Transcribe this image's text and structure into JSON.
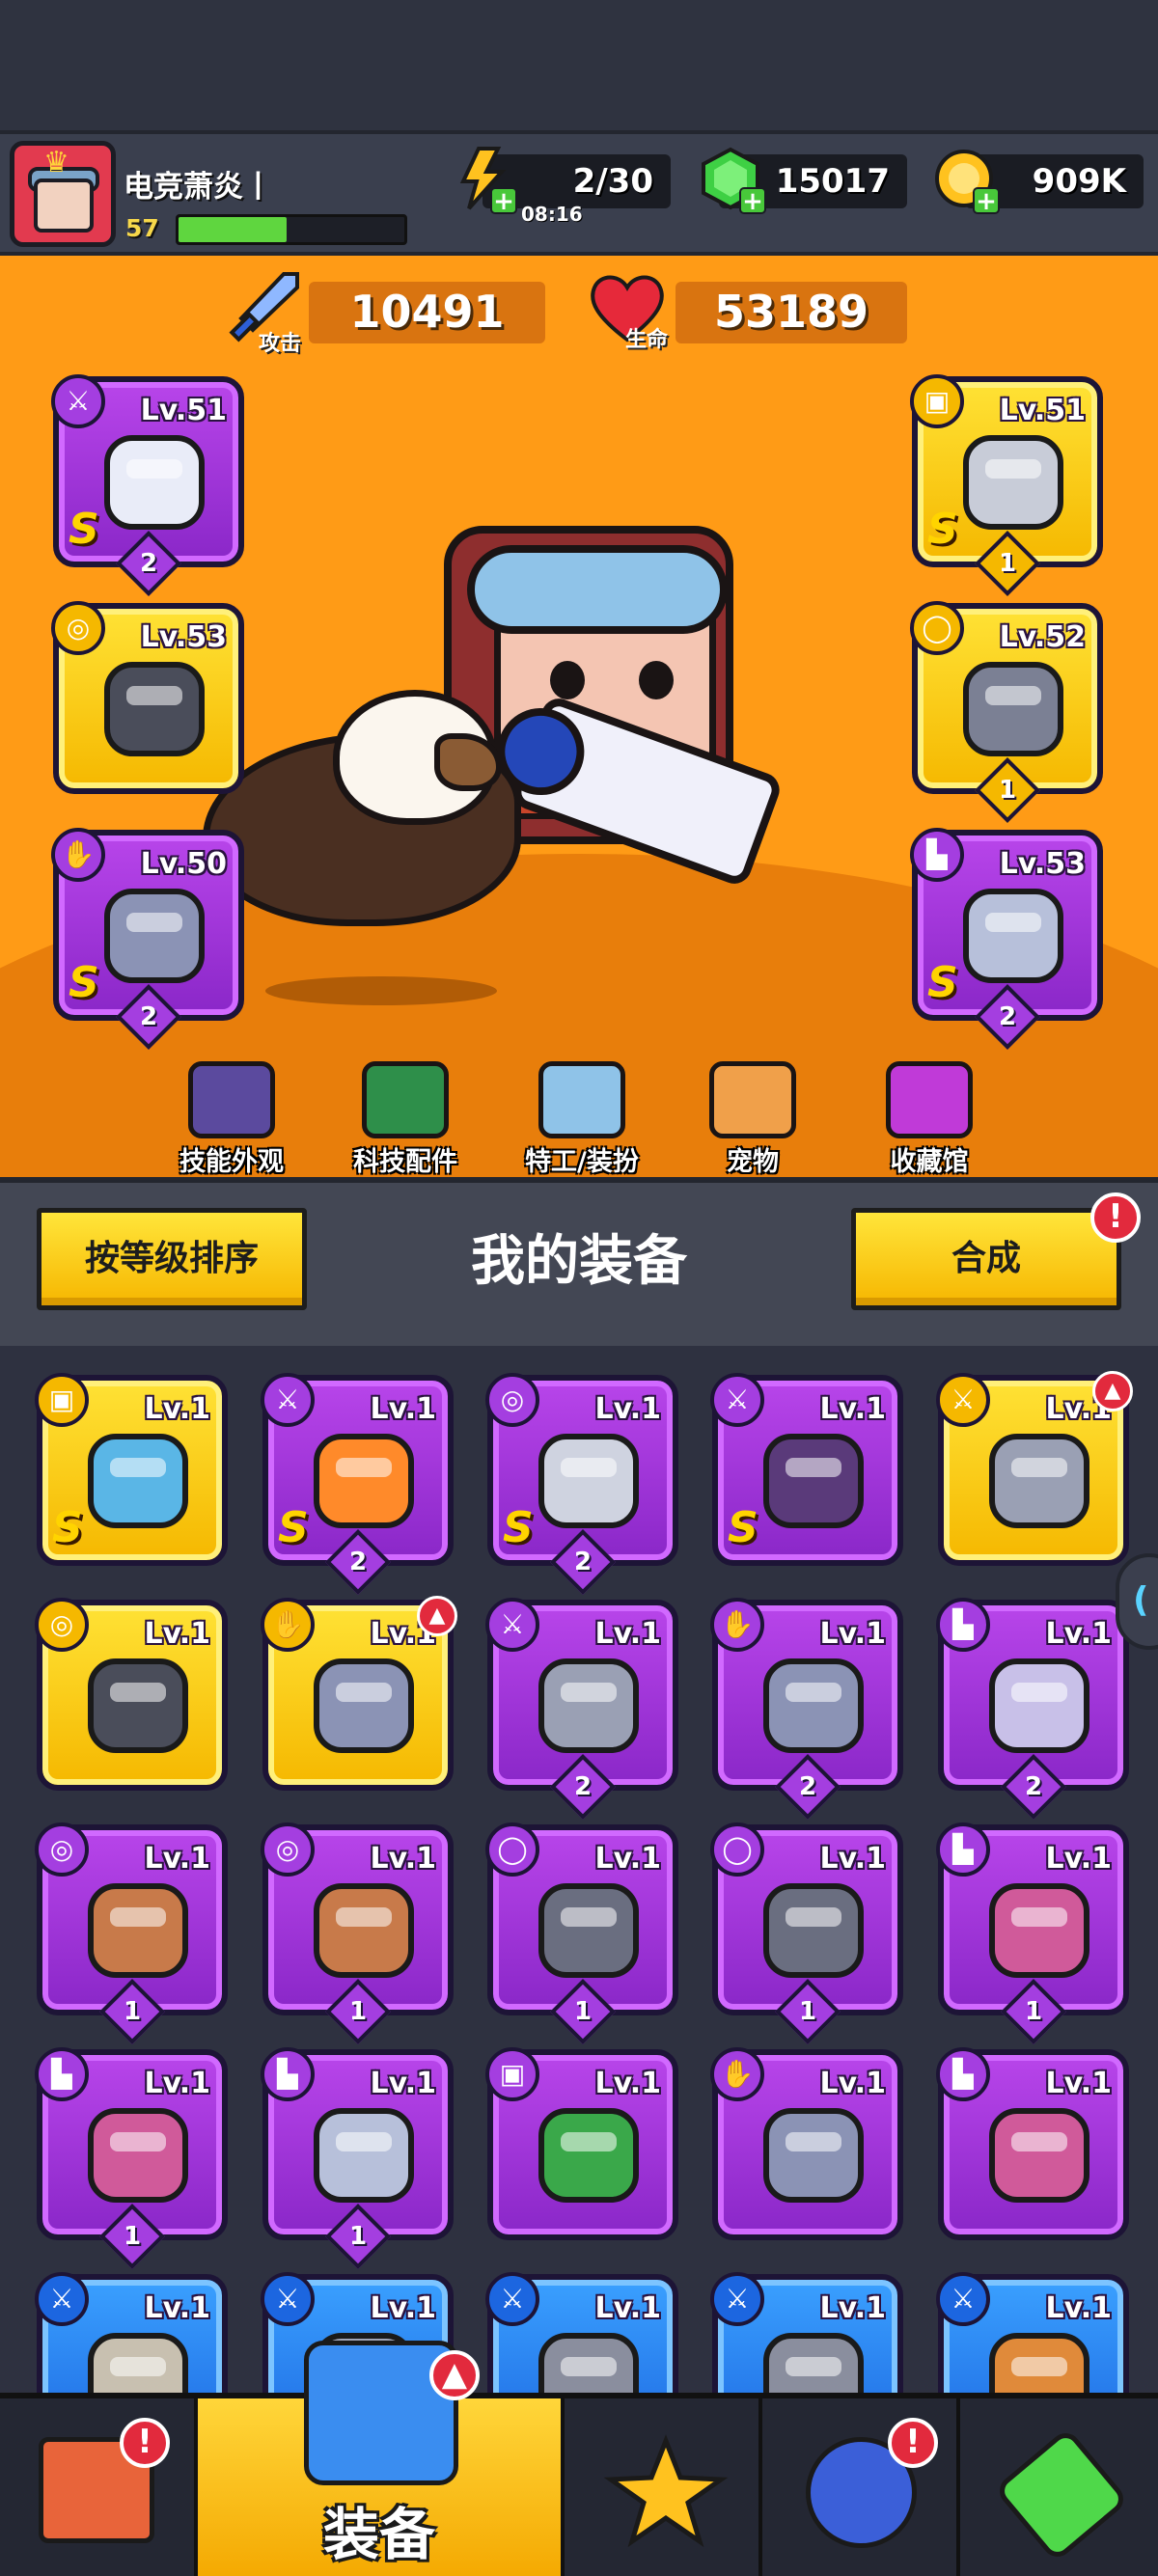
{
  "player": {
    "name": "电竞萧炎丨",
    "level": "57",
    "xp_fraction": 0.48
  },
  "resources": {
    "energy": "2/30",
    "energy_timer": "08:16",
    "gems": "15017",
    "coins": "909K"
  },
  "stats": {
    "attack_label": "攻击",
    "attack_value": "10491",
    "hp_label": "生命",
    "hp_value": "53189"
  },
  "equipped": [
    {
      "slot": "weapon",
      "lv": "Lv.51",
      "grade": "S",
      "stars": "2",
      "color": "purple",
      "icon": "gun-icon",
      "cat_icon": "sword-icon"
    },
    {
      "slot": "necklace",
      "lv": "Lv.53",
      "grade": "",
      "stars": "",
      "color": "yellow",
      "icon": "spiked-collar-icon",
      "cat_icon": "necklace-icon"
    },
    {
      "slot": "gloves",
      "lv": "Lv.50",
      "grade": "S",
      "stars": "2",
      "color": "purple",
      "icon": "gauntlet-icon",
      "cat_icon": "glove-icon"
    },
    {
      "slot": "armor",
      "lv": "Lv.51",
      "grade": "S",
      "stars": "1",
      "color": "yellow",
      "icon": "armor-icon",
      "cat_icon": "shirt-icon"
    },
    {
      "slot": "belt",
      "lv": "Lv.52",
      "grade": "",
      "stars": "1",
      "color": "yellow",
      "icon": "belt-icon",
      "cat_icon": "belt-icon"
    },
    {
      "slot": "boots",
      "lv": "Lv.53",
      "grade": "S",
      "stars": "2",
      "color": "purple",
      "icon": "boots-icon",
      "cat_icon": "boot-icon"
    }
  ],
  "hero_menu": [
    {
      "label": "技能外观",
      "icon": "skill-skin-icon",
      "color": "#5b4a9e"
    },
    {
      "label": "科技配件",
      "icon": "tech-parts-icon",
      "color": "#2e8f4a"
    },
    {
      "label": "特工/装扮",
      "icon": "agent-costume-icon",
      "color": "#8fc3e8"
    },
    {
      "label": "宠物",
      "icon": "pet-icon",
      "color": "#f0a04a"
    },
    {
      "label": "收藏馆",
      "icon": "collection-icon",
      "color": "#c03ad8"
    }
  ],
  "equipment_section": {
    "sort_label": "按等级排序",
    "title": "我的装备",
    "merge_label": "合成",
    "merge_alert": "!"
  },
  "inventory": [
    {
      "lv": "Lv.1",
      "grade": "S",
      "stars": "",
      "color": "yellow",
      "icon": "mech-armor-icon",
      "cat": "shirt-icon"
    },
    {
      "lv": "Lv.1",
      "grade": "S",
      "stars": "2",
      "color": "purple",
      "icon": "flame-sword-icon",
      "cat": "sword-icon"
    },
    {
      "lv": "Lv.1",
      "grade": "S",
      "stars": "2",
      "color": "purple",
      "icon": "star-necklace-icon",
      "cat": "necklace-icon"
    },
    {
      "lv": "Lv.1",
      "grade": "S",
      "stars": "",
      "color": "purple",
      "icon": "eye-blade-icon",
      "cat": "sword-icon"
    },
    {
      "lv": "Lv.1",
      "grade": "",
      "stars": "",
      "color": "yellow",
      "icon": "kunai-icon",
      "cat": "sword-icon",
      "badge": "armor-up-badge"
    },
    {
      "lv": "Lv.1",
      "grade": "",
      "stars": "",
      "color": "yellow",
      "icon": "spiked-collar-icon",
      "cat": "necklace-icon"
    },
    {
      "lv": "Lv.1",
      "grade": "",
      "stars": "",
      "color": "yellow",
      "icon": "gauntlet-icon",
      "cat": "glove-icon",
      "badge": "armor-up-badge"
    },
    {
      "lv": "Lv.1",
      "grade": "",
      "stars": "2",
      "color": "purple",
      "icon": "kunai-icon",
      "cat": "sword-icon"
    },
    {
      "lv": "Lv.1",
      "grade": "",
      "stars": "2",
      "color": "purple",
      "icon": "gauntlet-icon",
      "cat": "glove-icon"
    },
    {
      "lv": "Lv.1",
      "grade": "",
      "stars": "2",
      "color": "purple",
      "icon": "sneaker-icon",
      "cat": "boot-icon"
    },
    {
      "lv": "Lv.1",
      "grade": "",
      "stars": "1",
      "color": "purple",
      "icon": "fang-necklace-icon",
      "cat": "necklace-icon"
    },
    {
      "lv": "Lv.1",
      "grade": "",
      "stars": "1",
      "color": "purple",
      "icon": "fang-necklace-icon",
      "cat": "necklace-icon"
    },
    {
      "lv": "Lv.1",
      "grade": "",
      "stars": "1",
      "color": "purple",
      "icon": "star-belt-icon",
      "cat": "belt-icon"
    },
    {
      "lv": "Lv.1",
      "grade": "",
      "stars": "1",
      "color": "purple",
      "icon": "star-belt-icon",
      "cat": "belt-icon"
    },
    {
      "lv": "Lv.1",
      "grade": "",
      "stars": "1",
      "color": "purple",
      "icon": "claw-boots-icon",
      "cat": "boot-icon"
    },
    {
      "lv": "Lv.1",
      "grade": "",
      "stars": "1",
      "color": "purple",
      "icon": "claw-boots-icon",
      "cat": "boot-icon"
    },
    {
      "lv": "Lv.1",
      "grade": "",
      "stars": "1",
      "color": "purple",
      "icon": "boots-icon",
      "cat": "boot-icon"
    },
    {
      "lv": "Lv.1",
      "grade": "",
      "stars": "",
      "color": "purple",
      "icon": "leaf-armor-icon",
      "cat": "shirt-icon"
    },
    {
      "lv": "Lv.1",
      "grade": "",
      "stars": "",
      "color": "purple",
      "icon": "gauntlet-icon",
      "cat": "glove-icon"
    },
    {
      "lv": "Lv.1",
      "grade": "",
      "stars": "",
      "color": "purple",
      "icon": "claw-boots-icon",
      "cat": "boot-icon"
    },
    {
      "lv": "Lv.1",
      "grade": "",
      "stars": "",
      "color": "blue",
      "icon": "drill-icon",
      "cat": "sword-icon"
    },
    {
      "lv": "Lv.1",
      "grade": "",
      "stars": "",
      "color": "blue",
      "icon": "spear-icon",
      "cat": "sword-icon"
    },
    {
      "lv": "Lv.1",
      "grade": "",
      "stars": "",
      "color": "blue",
      "icon": "revolver-icon",
      "cat": "sword-icon"
    },
    {
      "lv": "Lv.1",
      "grade": "",
      "stars": "",
      "color": "blue",
      "icon": "revolver-icon",
      "cat": "sword-icon"
    },
    {
      "lv": "Lv.1",
      "grade": "",
      "stars": "",
      "color": "blue",
      "icon": "baseball-bat-icon",
      "cat": "sword-icon"
    }
  ],
  "bottom_nav": [
    {
      "label": "",
      "icon": "shop-icon",
      "alert": "!"
    },
    {
      "label": "装备",
      "icon": "equipment-icon",
      "alert": ""
    },
    {
      "label": "",
      "icon": "battle-star-icon",
      "alert": ""
    },
    {
      "label": "",
      "icon": "world-ball-icon",
      "alert": "!"
    },
    {
      "label": "",
      "icon": "dna-capsule-icon",
      "alert": ""
    }
  ],
  "colors": {
    "hero_bg": "#ff9b16",
    "rarity_purple": "#a43ee0",
    "rarity_yellow": "#f5b800",
    "rarity_blue": "#1c66e0",
    "alert_red": "#e22a3d",
    "xp_green": "#5fd63f"
  }
}
